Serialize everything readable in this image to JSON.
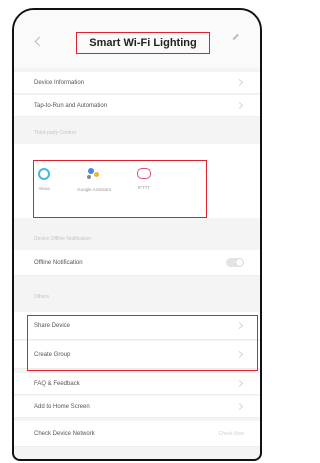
{
  "header": {
    "title": "Smart Wi-Fi Lighting"
  },
  "menu_top": [
    {
      "label": "Device Information"
    },
    {
      "label": "Tap-to-Run and Automation"
    }
  ],
  "sections": {
    "third_party": "Third-party Control",
    "offline": "Device Offline Notification",
    "others": "Others"
  },
  "services": [
    {
      "label": "Alexa",
      "icon": "alexa-icon"
    },
    {
      "label": "Google Assistant",
      "icon": "google-assistant-icon"
    },
    {
      "label": "IFTTT",
      "icon": "ifttt-icon"
    }
  ],
  "offline_row": {
    "label": "Offline Notification",
    "enabled": false
  },
  "menu_bottom": [
    {
      "label": "Share Device"
    },
    {
      "label": "Create Group"
    },
    {
      "label": "FAQ & Feedback"
    },
    {
      "label": "Add to Home Screen"
    },
    {
      "label": "Check Device Network",
      "note": "Check Now"
    }
  ],
  "colors": {
    "highlight": "#e0202a",
    "alexa": "#46b7e0",
    "ifttt": "#e0506a"
  }
}
